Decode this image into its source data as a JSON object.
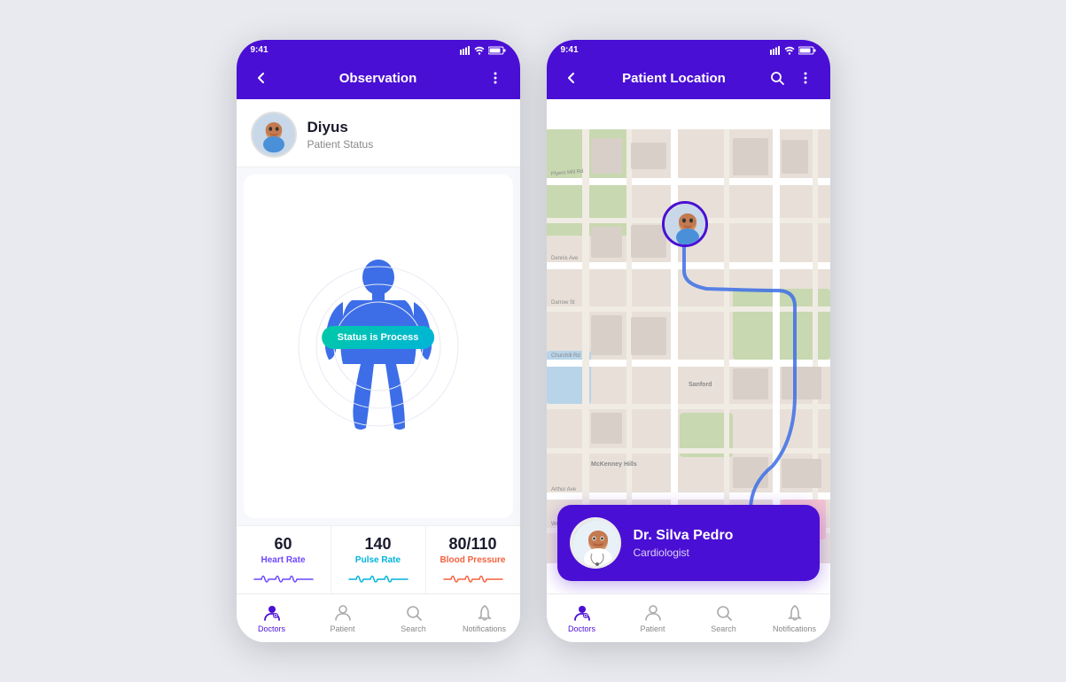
{
  "app": {
    "background_color": "#e8eaf0"
  },
  "phone1": {
    "status_bar": {
      "time": "9:41",
      "icons": "signal wifi battery"
    },
    "top_bar": {
      "title": "Observation",
      "back_icon": "chevron-left",
      "menu_icon": "more-vertical"
    },
    "patient": {
      "name": "Diyus",
      "status": "Patient Status"
    },
    "body_status": "Status is Process",
    "vitals": [
      {
        "value": "60",
        "label": "Heart Rate",
        "color_class": "heart",
        "wave_color": "#6c47ff"
      },
      {
        "value": "140",
        "label": "Pulse Rate",
        "color_class": "pulse",
        "wave_color": "#00b4d8"
      },
      {
        "value": "80/110",
        "label": "Blood Pressure",
        "color_class": "bp",
        "wave_color": "#f5603d"
      }
    ],
    "nav": [
      {
        "label": "Doctors",
        "icon": "doctors-icon",
        "active": true
      },
      {
        "label": "Patient",
        "icon": "patient-icon",
        "active": false
      },
      {
        "label": "Search",
        "icon": "search-icon",
        "active": false
      },
      {
        "label": "Notifications",
        "icon": "bell-icon",
        "active": false
      }
    ]
  },
  "phone2": {
    "status_bar": {
      "time": "9:41",
      "icons": "signal wifi battery"
    },
    "top_bar": {
      "title": "Patient Location",
      "back_icon": "chevron-left",
      "search_icon": "search-icon",
      "menu_icon": "more-vertical"
    },
    "doctor_card": {
      "name": "Dr. Silva Pedro",
      "specialty": "Cardiologist"
    },
    "nav": [
      {
        "label": "Doctors",
        "icon": "doctors-icon",
        "active": true
      },
      {
        "label": "Patient",
        "icon": "patient-icon",
        "active": false
      },
      {
        "label": "Search",
        "icon": "search-icon",
        "active": false
      },
      {
        "label": "Notifications",
        "icon": "bell-icon",
        "active": false
      }
    ]
  }
}
